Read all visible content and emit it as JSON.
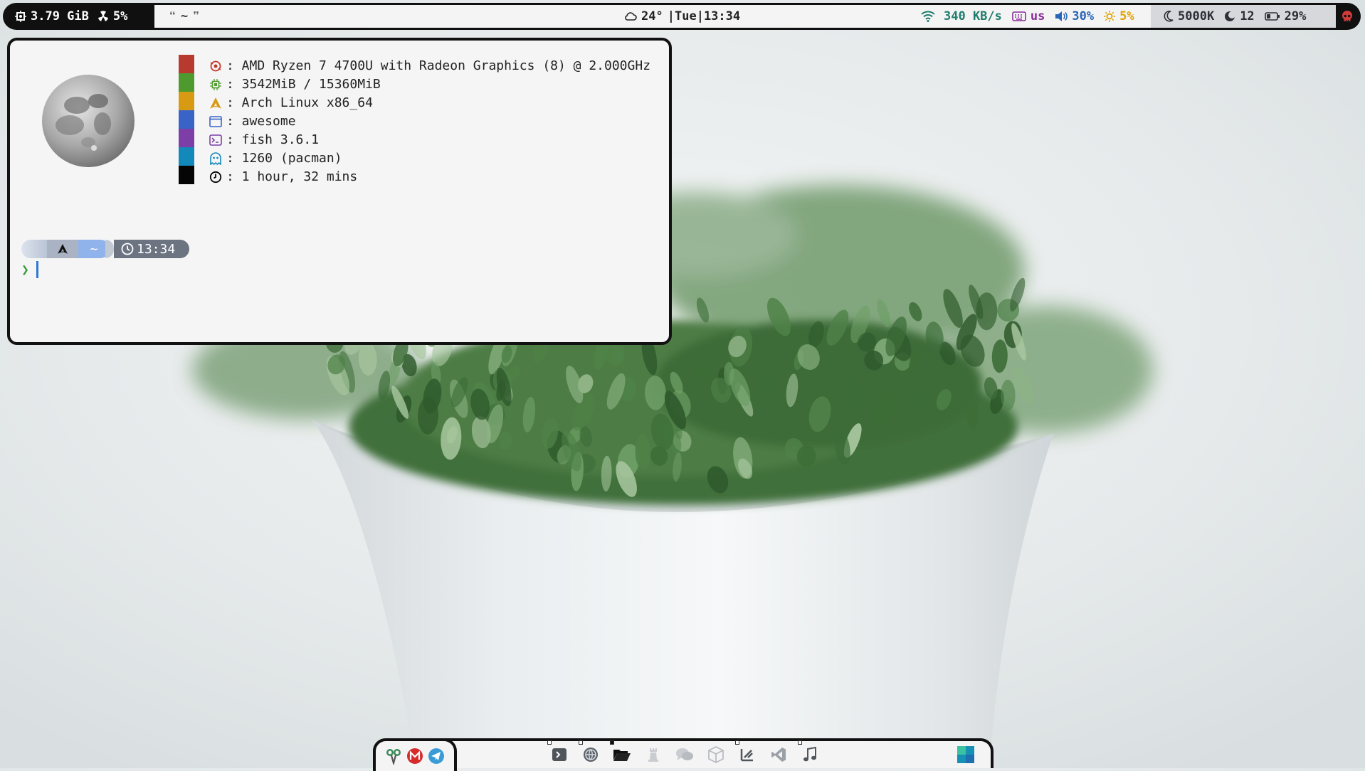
{
  "topbar": {
    "stats": {
      "memory": "3.79 GiB",
      "cpu": "5%"
    },
    "quote": {
      "open": "❝",
      "tilde": "~",
      "close": "❞"
    },
    "clock": {
      "weather": "24°",
      "sep1": "|",
      "day": "Tue",
      "sep2": "|",
      "time": "13:34"
    },
    "network": "340 KB/s",
    "keyboard": "us",
    "volume": "30%",
    "brightness": "5%",
    "system": {
      "color_temp": "5000K",
      "moon": "12",
      "battery": "29%"
    },
    "icons": [
      "cpu-icon",
      "radioactive-icon",
      "cloud-icon",
      "wifi-icon",
      "keyboard-icon",
      "volume-icon",
      "sun-icon",
      "moon-icon",
      "moon-phase-icon",
      "battery-icon",
      "skull-icon"
    ],
    "colors": {
      "bar_bg": "#101010",
      "network": "#1f7d6e",
      "keyboard": "#8a2b9a",
      "volume": "#2a65b8",
      "brightness": "#e0a400",
      "skull": "#d23a3a"
    }
  },
  "terminal": {
    "palette": [
      "#b83a2e",
      "#4f9a2f",
      "#d79a12",
      "#3a63c8",
      "#7d3ea8",
      "#1388bb",
      "#050505"
    ],
    "info": [
      {
        "icon": "cpu-icon",
        "color": "#c0392b",
        "text": ": AMD Ryzen 7 4700U with Radeon Graphics (8) @ 2.000GHz"
      },
      {
        "icon": "memory-chip-icon",
        "color": "#4f9a2f",
        "text": ": 3542MiB / 15360MiB"
      },
      {
        "icon": "arch-linux-icon",
        "color": "#d79a12",
        "text": ": Arch Linux x86_64"
      },
      {
        "icon": "window-icon",
        "color": "#3a63c8",
        "text": ": awesome"
      },
      {
        "icon": "terminal-icon",
        "color": "#7d3ea8",
        "text": ": fish 3.6.1"
      },
      {
        "icon": "ghost-package-icon",
        "color": "#1388bb",
        "text": ": 1260 (pacman)"
      },
      {
        "icon": "clock-icon",
        "color": "#050505",
        "text": ": 1 hour, 32 mins"
      }
    ],
    "prompt": {
      "dir": "~",
      "time": "13:34",
      "chevron": "❯"
    }
  },
  "dock": {
    "left_icons": [
      "scissors-tool-icon",
      "mail-icon",
      "telegram-icon"
    ],
    "apps": [
      "terminal-icon",
      "browser-icon",
      "file-manager-icon",
      "chess-icon",
      "chat-icon",
      "package-icon",
      "editor-icon",
      "vscode-icon",
      "music-icon"
    ],
    "layout_icon": "tile-layout-icon"
  }
}
